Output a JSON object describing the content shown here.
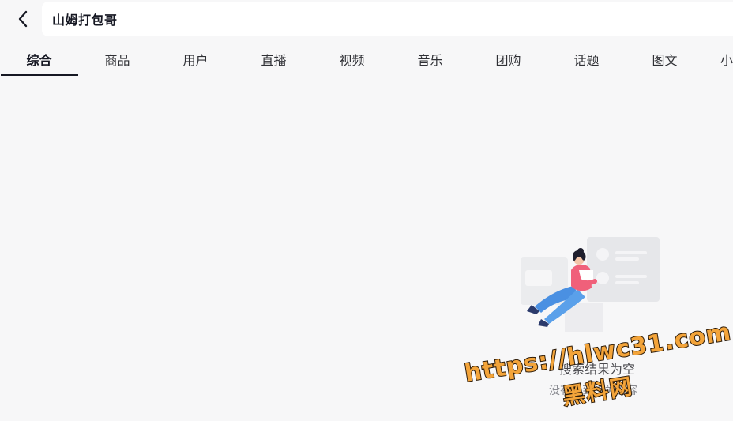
{
  "search": {
    "query": "山姆打包哥"
  },
  "tabs": [
    {
      "label": "综合",
      "active": true
    },
    {
      "label": "商品",
      "active": false
    },
    {
      "label": "用户",
      "active": false
    },
    {
      "label": "直播",
      "active": false
    },
    {
      "label": "视频",
      "active": false
    },
    {
      "label": "音乐",
      "active": false
    },
    {
      "label": "团购",
      "active": false
    },
    {
      "label": "话题",
      "active": false
    },
    {
      "label": "图文",
      "active": false
    },
    {
      "label": "小",
      "active": false
    }
  ],
  "empty_state": {
    "title": "搜索结果为空",
    "description": "没有找到相关内容"
  },
  "watermark": {
    "url": "https://hlwc31.com",
    "name": "黑料网"
  },
  "colors": {
    "background": "#f7f7f8",
    "search_box": "#ffffff",
    "text_primary": "#161823",
    "text_secondary": "#8a8b91",
    "illustration_blue": "#4a90e2",
    "illustration_pink": "#f0607a",
    "watermark_fill": "#f3a43a"
  },
  "icons": {
    "back": "chevron-left-icon",
    "illustration": "empty-result-illustration"
  }
}
